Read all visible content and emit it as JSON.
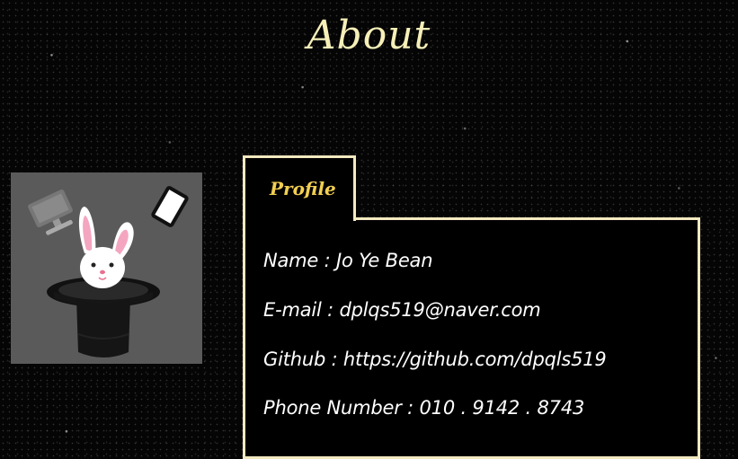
{
  "page": {
    "title": "About"
  },
  "avatar": {
    "icon": "magic-hat-rabbit-icon",
    "background_color": "#5a5a5a"
  },
  "profile": {
    "tab_label": "Profile",
    "rows": [
      {
        "label": "Name",
        "separator": " : ",
        "value": "Jo Ye Bean"
      },
      {
        "label": "E-mail",
        "separator": " : ",
        "value": "dplqs519@naver.com"
      },
      {
        "label": "Github",
        "separator": " : ",
        "value": "https://github.com/dpqls519"
      },
      {
        "label": "Phone Number",
        "separator": " : ",
        "value": "010 . 9142 . 8743"
      }
    ]
  },
  "colors": {
    "title": "#f6efb8",
    "tab_label": "#f2cf52",
    "border": "#f3e9c0",
    "text": "#ffffff"
  }
}
